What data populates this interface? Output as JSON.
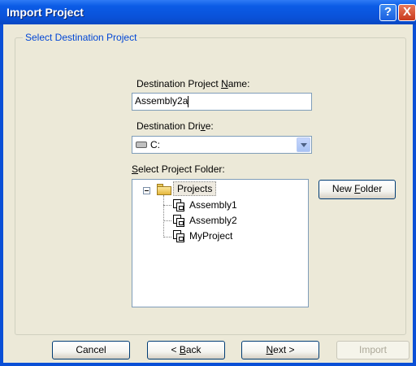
{
  "window": {
    "title": "Import Project"
  },
  "titlebar_buttons": {
    "help": "?",
    "close": "X"
  },
  "group": {
    "label": "Select Destination Project"
  },
  "name_field": {
    "label_pre": "Destination Project ",
    "label_accel": "N",
    "label_post": "ame:",
    "value": "Assembly2a"
  },
  "drive_field": {
    "label_pre": "Destination Dri",
    "label_accel": "v",
    "label_post": "e:",
    "value": "C:"
  },
  "folder_field": {
    "label_pre": "",
    "label_accel": "S",
    "label_post": "elect Project Folder:"
  },
  "tree": {
    "root": "Projects",
    "items": [
      "Assembly1",
      "Assembly2",
      "MyProject"
    ]
  },
  "new_folder_button": {
    "pre": "New ",
    "accel": "F",
    "post": "older"
  },
  "buttons": {
    "cancel": "Cancel",
    "back_pre": "< ",
    "back_accel": "B",
    "back_post": "ack",
    "next_accel": "N",
    "next_post": "ext >",
    "import": "Import"
  },
  "icons": {
    "help": "help-icon",
    "close": "close-icon",
    "folder": "folder-icon",
    "project": "project-icon",
    "drive": "drive-icon"
  }
}
